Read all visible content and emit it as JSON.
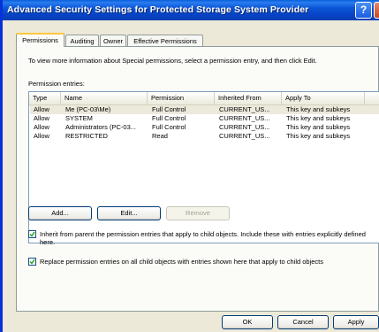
{
  "window": {
    "title": "Advanced Security Settings for Protected Storage System Provider",
    "help_label": "?",
    "close_label": "X"
  },
  "tabs": [
    {
      "label": "Permissions"
    },
    {
      "label": "Auditing"
    },
    {
      "label": "Owner"
    },
    {
      "label": "Effective Permissions"
    }
  ],
  "permissions": {
    "info_text": "To view more information about Special permissions, select a permission entry, and then click Edit.",
    "entries_label": "Permission entries:",
    "columns": [
      "Type",
      "Name",
      "Permission",
      "Inherited From",
      "Apply To"
    ],
    "rows": [
      {
        "type": "Allow",
        "name": "Me (PC-03\\Me)",
        "permission": "Full Control",
        "inherited_from": "CURRENT_US...",
        "apply_to": "This key and subkeys"
      },
      {
        "type": "Allow",
        "name": "SYSTEM",
        "permission": "Full Control",
        "inherited_from": "CURRENT_US...",
        "apply_to": "This key and subkeys"
      },
      {
        "type": "Allow",
        "name": "Administrators (PC-03...",
        "permission": "Full Control",
        "inherited_from": "CURRENT_US...",
        "apply_to": "This key and subkeys"
      },
      {
        "type": "Allow",
        "name": "RESTRICTED",
        "permission": "Read",
        "inherited_from": "CURRENT_US...",
        "apply_to": "This key and subkeys"
      }
    ],
    "buttons": {
      "add": "Add...",
      "edit": "Edit...",
      "remove": "Remove"
    },
    "inherit_checkbox": {
      "checked": true,
      "label": "Inherit from parent the permission entries that apply to child objects. Include these with entries explicitly defined here."
    },
    "replace_checkbox": {
      "checked": true,
      "label": "Replace permission entries on all child objects with entries shown here that apply to child objects"
    }
  },
  "dialog_buttons": {
    "ok": "OK",
    "cancel": "Cancel",
    "apply": "Apply"
  }
}
